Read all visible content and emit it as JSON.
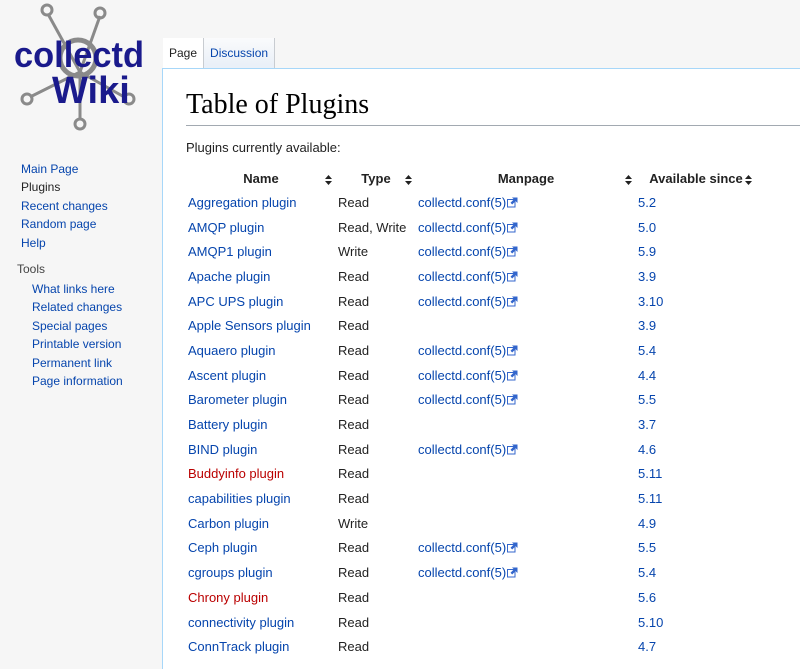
{
  "logo": {
    "line1": "collectd",
    "line2": "Wiki"
  },
  "nav": {
    "items": [
      {
        "label": "Main Page",
        "selected": false
      },
      {
        "label": "Plugins",
        "selected": true
      },
      {
        "label": "Recent changes",
        "selected": false
      },
      {
        "label": "Random page",
        "selected": false
      },
      {
        "label": "Help",
        "selected": false
      }
    ]
  },
  "tools": {
    "heading": "Tools",
    "items": [
      "What links here",
      "Related changes",
      "Special pages",
      "Printable version",
      "Permanent link",
      "Page information"
    ]
  },
  "tabs": [
    {
      "label": "Page",
      "active": true
    },
    {
      "label": "Discussion",
      "active": false
    }
  ],
  "page": {
    "title": "Table of Plugins",
    "intro": "Plugins currently available:"
  },
  "table": {
    "headers": [
      "Name",
      "Type",
      "Manpage",
      "Available since"
    ],
    "rows": [
      {
        "name": "Aggregation plugin",
        "type": "Read",
        "manpage": "collectd.conf(5)",
        "since": "5.2",
        "new": false
      },
      {
        "name": "AMQP plugin",
        "type": "Read, Write",
        "manpage": "collectd.conf(5)",
        "since": "5.0",
        "new": false
      },
      {
        "name": "AMQP1 plugin",
        "type": "Write",
        "manpage": "collectd.conf(5)",
        "since": "5.9",
        "new": false
      },
      {
        "name": "Apache plugin",
        "type": "Read",
        "manpage": "collectd.conf(5)",
        "since": "3.9",
        "new": false
      },
      {
        "name": "APC UPS plugin",
        "type": "Read",
        "manpage": "collectd.conf(5)",
        "since": "3.10",
        "new": false
      },
      {
        "name": "Apple Sensors plugin",
        "type": "Read",
        "manpage": "",
        "since": "3.9",
        "new": false
      },
      {
        "name": "Aquaero plugin",
        "type": "Read",
        "manpage": "collectd.conf(5)",
        "since": "5.4",
        "new": false
      },
      {
        "name": "Ascent plugin",
        "type": "Read",
        "manpage": "collectd.conf(5)",
        "since": "4.4",
        "new": false
      },
      {
        "name": "Barometer plugin",
        "type": "Read",
        "manpage": "collectd.conf(5)",
        "since": "5.5",
        "new": false
      },
      {
        "name": "Battery plugin",
        "type": "Read",
        "manpage": "",
        "since": "3.7",
        "new": false
      },
      {
        "name": "BIND plugin",
        "type": "Read",
        "manpage": "collectd.conf(5)",
        "since": "4.6",
        "new": false
      },
      {
        "name": "Buddyinfo plugin",
        "type": "Read",
        "manpage": "",
        "since": "5.11",
        "new": true
      },
      {
        "name": "capabilities plugin",
        "type": "Read",
        "manpage": "",
        "since": "5.11",
        "new": false
      },
      {
        "name": "Carbon plugin",
        "type": "Write",
        "manpage": "",
        "since": "4.9",
        "new": false
      },
      {
        "name": "Ceph plugin",
        "type": "Read",
        "manpage": "collectd.conf(5)",
        "since": "5.5",
        "new": false
      },
      {
        "name": "cgroups plugin",
        "type": "Read",
        "manpage": "collectd.conf(5)",
        "since": "5.4",
        "new": false
      },
      {
        "name": "Chrony plugin",
        "type": "Read",
        "manpage": "",
        "since": "5.6",
        "new": true
      },
      {
        "name": "connectivity plugin",
        "type": "Read",
        "manpage": "",
        "since": "5.10",
        "new": false
      },
      {
        "name": "ConnTrack plugin",
        "type": "Read",
        "manpage": "",
        "since": "4.7",
        "new": false
      }
    ]
  },
  "colors": {
    "link": "#0645ad",
    "new_link": "#ba0000",
    "logo_blue": "#1a1a8c",
    "logo_gray": "#8a8a8a"
  }
}
